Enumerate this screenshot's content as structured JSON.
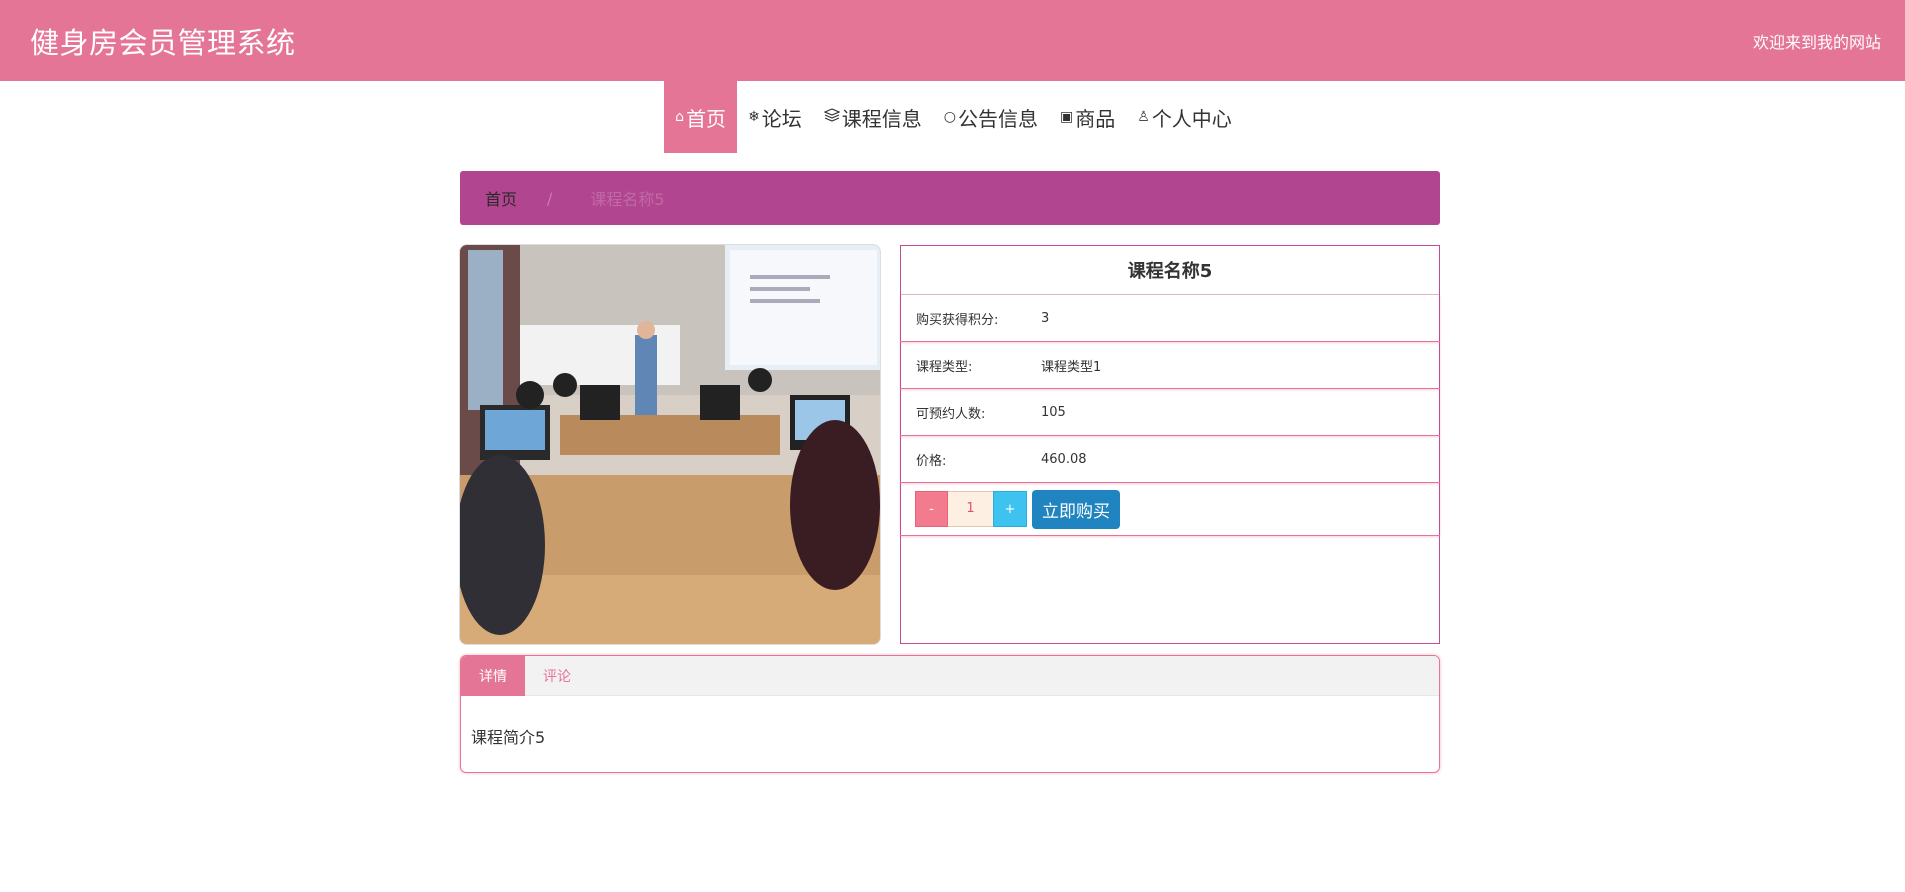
{
  "header": {
    "title": "健身房会员管理系统",
    "welcome": "欢迎来到我的网站"
  },
  "nav": {
    "items": [
      {
        "icon": "home-icon",
        "glyph": "⌂",
        "label": "首页"
      },
      {
        "icon": "snowflake-icon",
        "glyph": "❄",
        "label": "论坛"
      },
      {
        "icon": "book-icon",
        "glyph": "📚",
        "label": "课程信息"
      },
      {
        "icon": "bubble-icon",
        "glyph": "○",
        "label": "公告信息"
      },
      {
        "icon": "gift-icon",
        "glyph": "▣",
        "label": "商品"
      },
      {
        "icon": "user-icon",
        "glyph": "♙",
        "label": "个人中心"
      }
    ]
  },
  "breadcrumb": {
    "home": "首页",
    "separator": "/",
    "current": "课程名称5"
  },
  "product": {
    "name": "课程名称5",
    "fields": [
      {
        "label": "购买获得积分:",
        "value": "3"
      },
      {
        "label": "课程类型:",
        "value": "课程类型1"
      },
      {
        "label": "可预约人数:",
        "value": "105"
      },
      {
        "label": "价格:",
        "value": "460.08"
      }
    ],
    "minus": "-",
    "quantity": "1",
    "plus": "+",
    "buy_label": "立即购买"
  },
  "tabs": {
    "items": [
      {
        "label": "详情"
      },
      {
        "label": "评论"
      }
    ],
    "content": "课程简介5"
  },
  "colors": {
    "brand": "#e57596",
    "breadcrumb": "#b1458f",
    "buy": "#1f84c0",
    "plus": "#3ec3f0",
    "minus": "#f37b8e"
  }
}
